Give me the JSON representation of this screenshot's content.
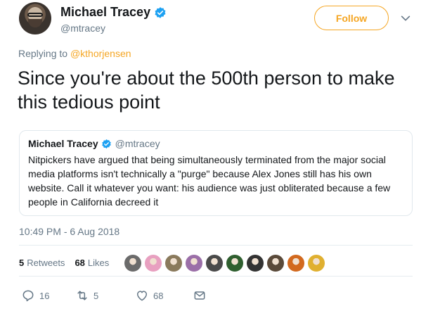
{
  "author": {
    "display_name": "Michael Tracey",
    "handle": "@mtracey"
  },
  "follow_label": "Follow",
  "replying": {
    "prefix": "Replying to ",
    "mention": "@kthorjensen"
  },
  "tweet_text": "Since you're about the 500th person to make this tedious point",
  "quoted": {
    "display_name": "Michael Tracey",
    "handle": "@mtracey",
    "text": "Nitpickers have argued that being simultaneously terminated from the major social media platforms isn't technically a \"purge\" because Alex Jones still has his own website. Call it whatever you want: his audience was just obliterated because a few people in California decreed it"
  },
  "timestamp": "10:49 PM - 6 Aug 2018",
  "stats": {
    "retweets_count": "5",
    "retweets_label": "Retweets",
    "likes_count": "68",
    "likes_label": "Likes"
  },
  "likers": [
    "#6b6b6b",
    "#e8a0c0",
    "#8a7a5c",
    "#9b6fa8",
    "#4a4a4a",
    "#2f5f2f",
    "#333333",
    "#5a4a3a",
    "#d2691e",
    "#e0b030"
  ],
  "actions": {
    "reply_count": "16",
    "retweet_count": "5",
    "like_count": "68"
  },
  "colors": {
    "accent": "#f5a623",
    "verified": "#1da1f2",
    "muted": "#657786"
  },
  "icons": [
    "verified-badge-icon",
    "chevron-down-icon",
    "reply-icon",
    "retweet-icon",
    "heart-icon",
    "direct-message-icon"
  ]
}
